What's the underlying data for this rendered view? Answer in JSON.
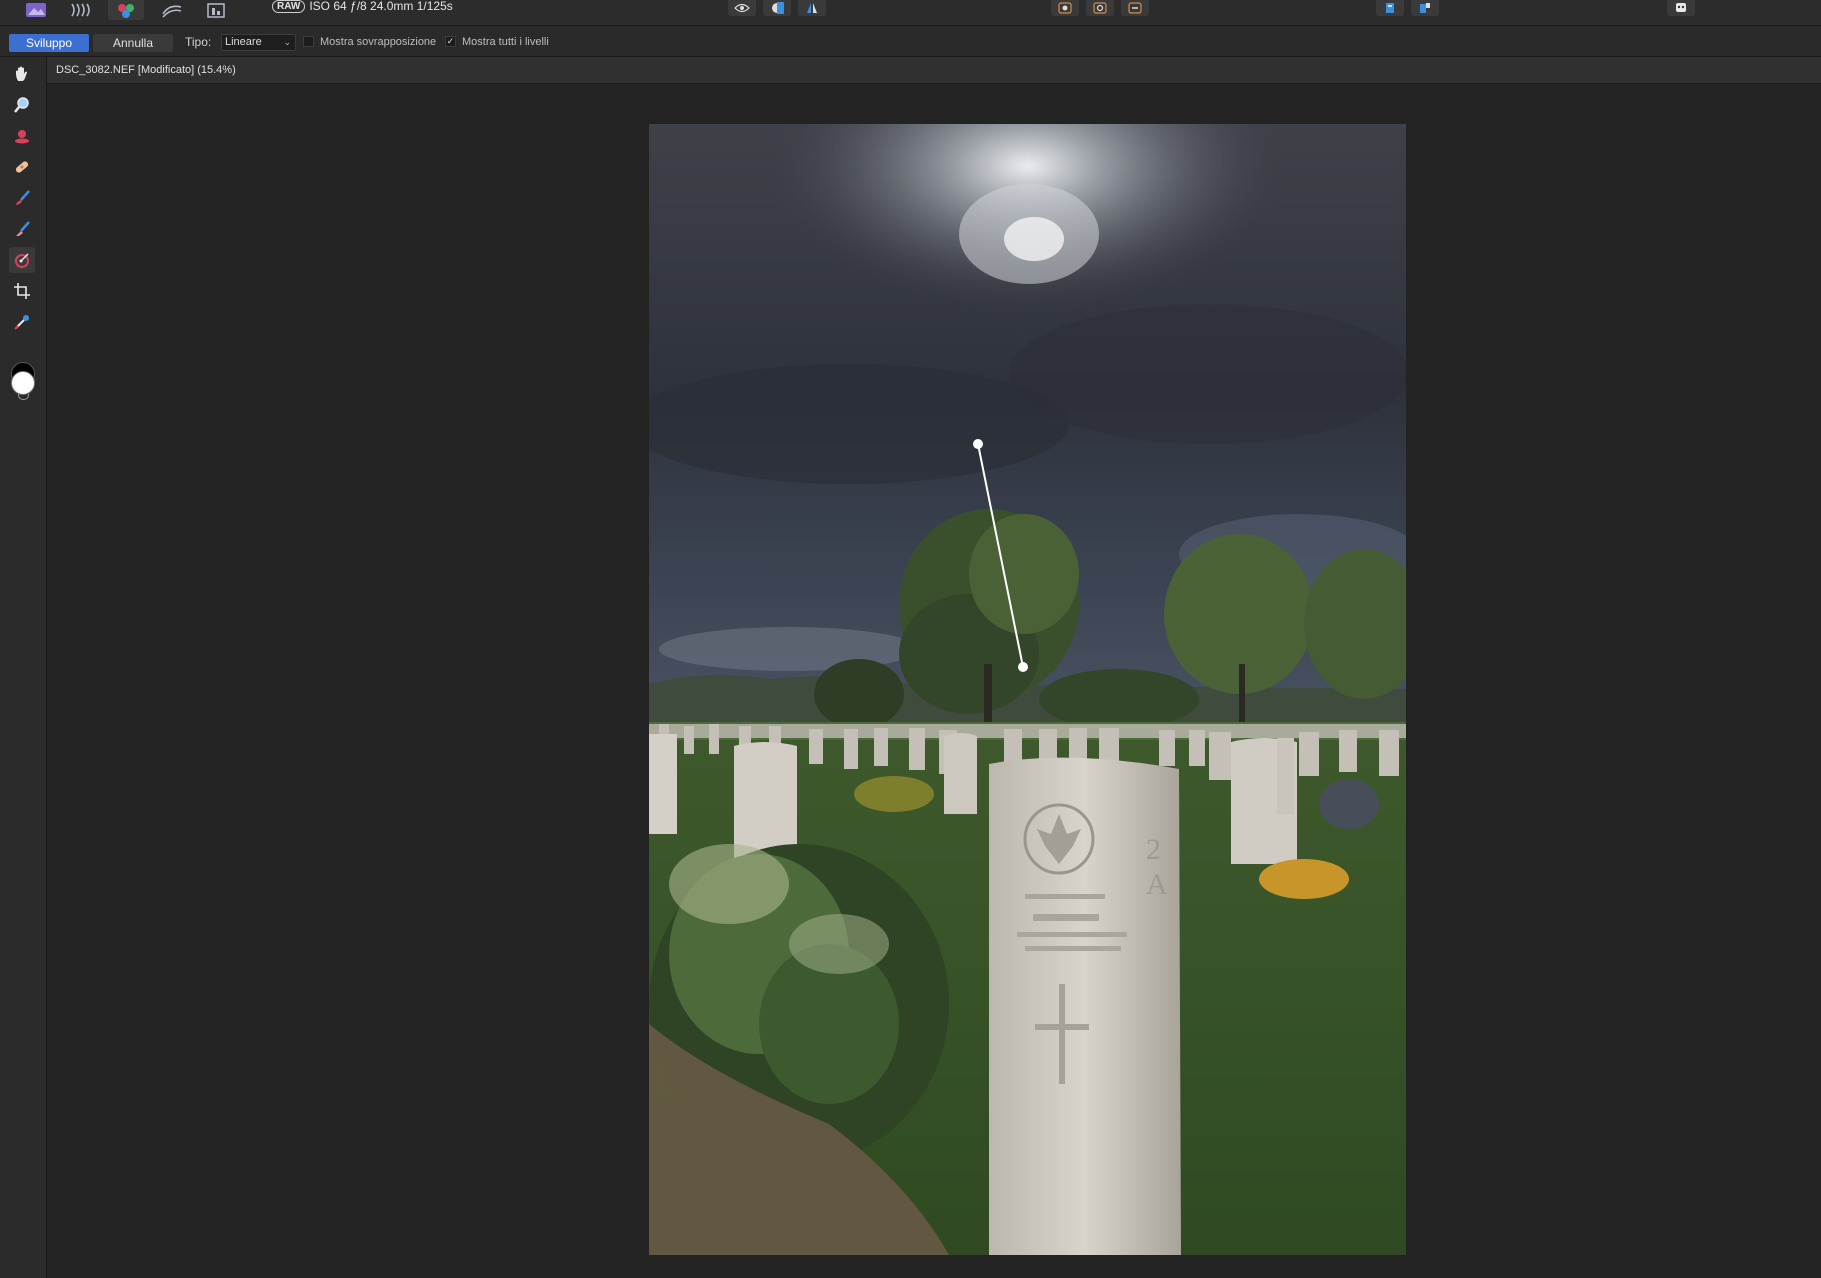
{
  "topbar": {
    "personas": [
      {
        "name": "photo-persona-icon"
      },
      {
        "name": "liquify-persona-icon"
      },
      {
        "name": "develop-persona-icon"
      },
      {
        "name": "tone-mapping-persona-icon"
      },
      {
        "name": "export-persona-icon"
      }
    ],
    "raw_badge": "RAW",
    "exif": "ISO 64 ƒ/8 24.0mm 1/125s"
  },
  "context": {
    "develop_label": "Sviluppo",
    "undo_label": "Annulla",
    "type_label": "Tipo:",
    "type_value": "Lineare",
    "show_overlay_label": "Mostra sovrapposizione",
    "show_overlay_checked": false,
    "show_all_layers_label": "Mostra tutti i livelli",
    "show_all_layers_checked": true
  },
  "tools": [
    "hand-tool-icon",
    "zoom-tool-icon",
    "red-eye-tool-icon",
    "blemish-tool-icon",
    "brush-tool-icon",
    "erase-tool-icon",
    "overlay-gradient-tool-icon",
    "crop-tool-icon",
    "white-balance-tool-icon"
  ],
  "document": {
    "title": "DSC_3082.NEF [Modificato] (15.4%)"
  },
  "colors": {
    "accent": "#3d6fd1",
    "panel": "#2b2b2b",
    "canvas": "#232323"
  }
}
